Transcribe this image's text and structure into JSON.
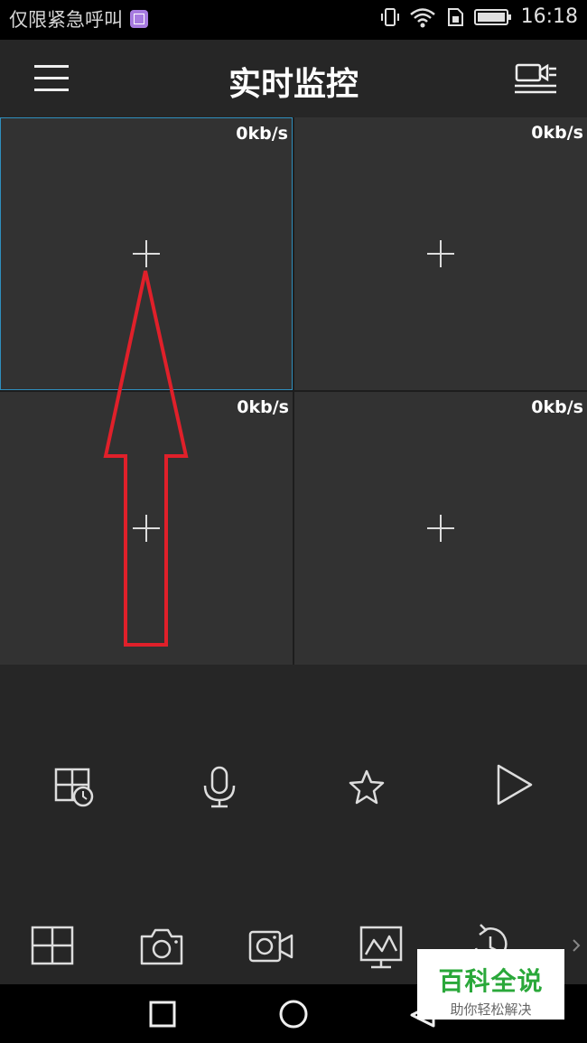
{
  "status_bar": {
    "left_text": "仅限紧急呼叫",
    "time": "16:18",
    "icons": [
      "vibrate-icon",
      "wifi-icon",
      "sim-icon",
      "battery-icon"
    ]
  },
  "header": {
    "title": "实时监控",
    "menu_icon": "menu-icon",
    "device_icon": "device-list-icon"
  },
  "grid": {
    "cells": [
      {
        "rate": "0kb/s"
      },
      {
        "rate": "0kb/s"
      },
      {
        "rate": "0kb/s"
      },
      {
        "rate": "0kb/s"
      }
    ]
  },
  "controls": {
    "icons": [
      "playback-icon",
      "microphone-icon",
      "favorite-star-icon",
      "play-icon"
    ]
  },
  "bottom_toolbar": {
    "icons": [
      "grid-layout-icon",
      "snapshot-camera-icon",
      "record-video-icon",
      "performance-chart-icon",
      "rotate-icon",
      "chevron-right-icon"
    ]
  },
  "nav_bar": {
    "icons": [
      "recent-apps-icon",
      "home-icon",
      "back-icon"
    ]
  },
  "watermark": {
    "main": "百科全说",
    "sub": "助你轻松解决"
  },
  "colors": {
    "selected_border": "#2f8ebd",
    "annotation_arrow": "#e0202a"
  }
}
